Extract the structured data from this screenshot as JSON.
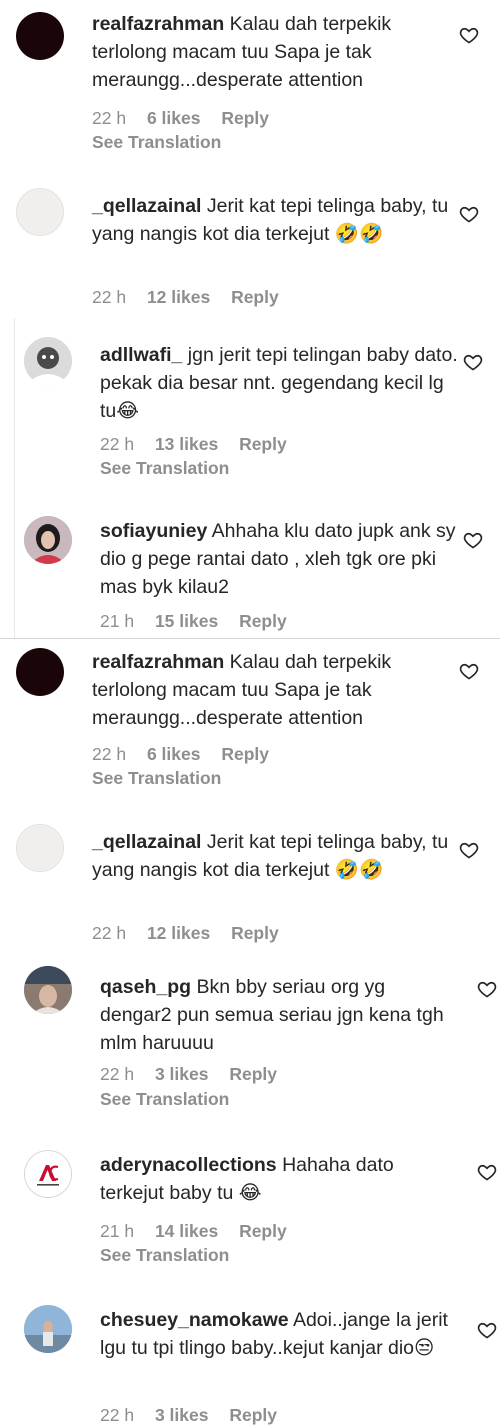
{
  "comments": [
    {
      "username": "realfazrahman",
      "text": "Kalau dah terpekik terlolong macam tuu Sapa je tak meraungg...desperate attention",
      "time": "22 h",
      "likes": "6 likes",
      "reply": "Reply",
      "see_translation": "See Translation"
    },
    {
      "username": "_qellazainal",
      "text": "Jerit kat tepi telinga baby, tu yang nangis kot dia terkejut 🤣🤣",
      "time": "22 h",
      "likes": "12 likes",
      "reply": "Reply"
    },
    {
      "username": "adllwafi_",
      "text": "jgn jerit tepi telingan baby dato. pekak dia besar nnt. gegendang kecil lg tu😂",
      "time": "22 h",
      "likes": "13 likes",
      "reply": "Reply",
      "see_translation": "See Translation"
    },
    {
      "username": "sofiayuniey",
      "text": "Ahhaha klu dato jupk ank sy dio g pege rantai dato , xleh tgk ore pki mas byk kilau2",
      "time": "21 h",
      "likes": "15 likes",
      "reply": "Reply"
    },
    {
      "username": "realfazrahman",
      "text": "Kalau dah terpekik terlolong macam tuu Sapa je tak meraungg...desperate attention",
      "time": "22 h",
      "likes": "6 likes",
      "reply": "Reply",
      "see_translation": "See Translation"
    },
    {
      "username": "_qellazainal",
      "text": "Jerit kat tepi telinga baby, tu yang nangis kot dia terkejut 🤣🤣",
      "time": "22 h",
      "likes": "12 likes",
      "reply": "Reply"
    },
    {
      "username": "qaseh_pg",
      "text": "Bkn bby seriau org yg dengar2 pun semua seriau jgn kena tgh mlm haruuuu",
      "time": "22 h",
      "likes": "3 likes",
      "reply": "Reply",
      "see_translation": "See Translation"
    },
    {
      "username": "aderynacollections",
      "text": "Hahaha dato terkejut baby tu 😂",
      "time": "21 h",
      "likes": "14 likes",
      "reply": "Reply",
      "see_translation": "See Translation"
    },
    {
      "username": "chesuey_namokawe",
      "text": "Adoi..jange la jerit lgu tu tpi tlingo baby..kejut kanjar dio😒",
      "time": "22 h",
      "likes": "3 likes",
      "reply": "Reply"
    }
  ],
  "colors": {
    "text": "#262626",
    "meta": "#8e8e8e",
    "divider": "#d6d6d6"
  },
  "icons": {
    "like": "heart-outline-icon"
  }
}
